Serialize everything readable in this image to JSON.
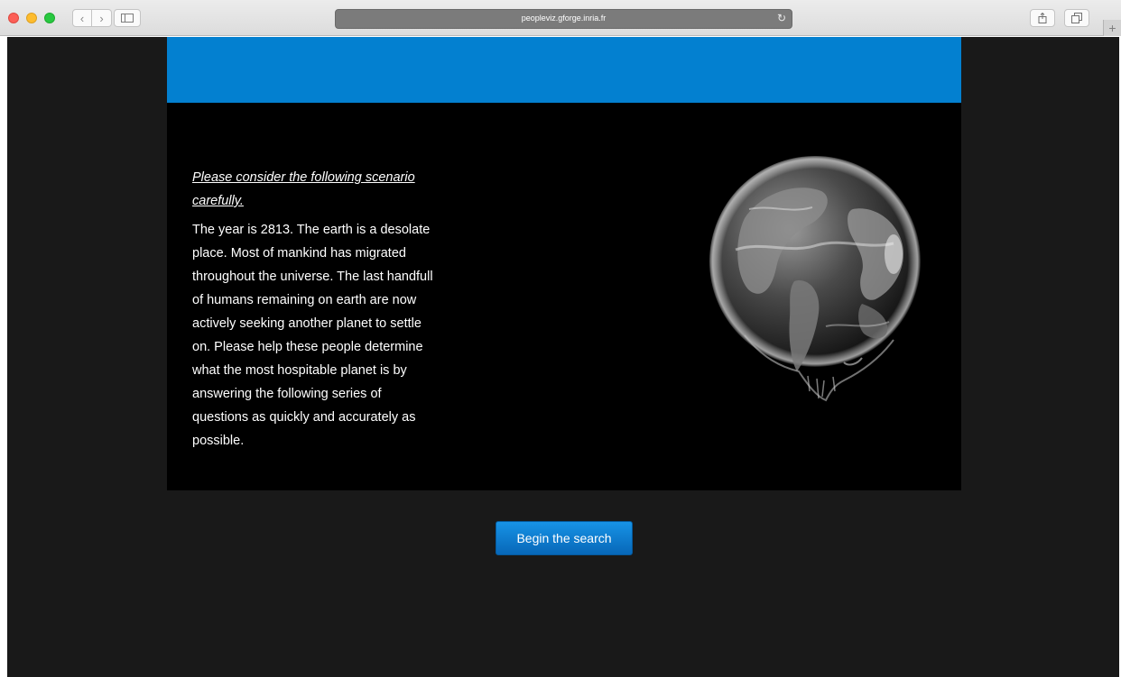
{
  "browser": {
    "url": "peopleviz.gforge.inria.fr",
    "icons": {
      "back": "chevron-left-icon",
      "forward": "chevron-right-icon",
      "sidebar": "sidebar-icon",
      "reload": "reload-icon",
      "share": "share-icon",
      "tabs": "tabs-icon",
      "new_tab": "plus-icon"
    }
  },
  "page": {
    "intro_heading": "Please consider the following scenario carefully.",
    "intro_text": "The year is 2813. The earth is a desolate place. Most of mankind has migrated throughout the universe. The last handfull of humans remaining on earth are now actively seeking another planet to settle on. Please help these people determine what the most hospitable planet is by answering the following series of questions as quickly and accurately as possible.",
    "image": "earth-globe",
    "button_label": "Begin the search"
  },
  "colors": {
    "header_blue": "#0380d0",
    "panel_black": "#000000",
    "page_background": "#191919",
    "button_blue": "#0d7ad0"
  }
}
